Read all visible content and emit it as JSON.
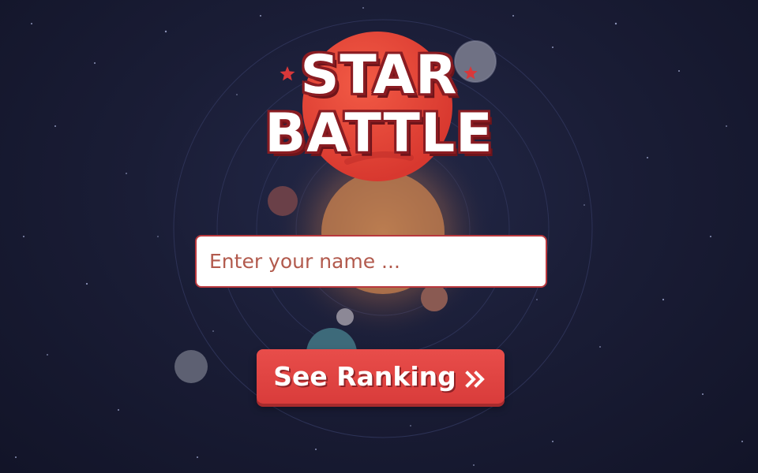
{
  "title": {
    "line1": "STAR",
    "line2": "BATTLE"
  },
  "name_input": {
    "placeholder": "Enter your name ...",
    "value": ""
  },
  "ranking_button": {
    "label": "See Ranking",
    "icon": "double-chevron-right-icon"
  },
  "colors": {
    "background": "#1a1d36",
    "accent_red": "#e84d4a",
    "planet_red": "#e8483d",
    "title_outline": "#8a1c22",
    "input_text": "#b25a4d"
  }
}
